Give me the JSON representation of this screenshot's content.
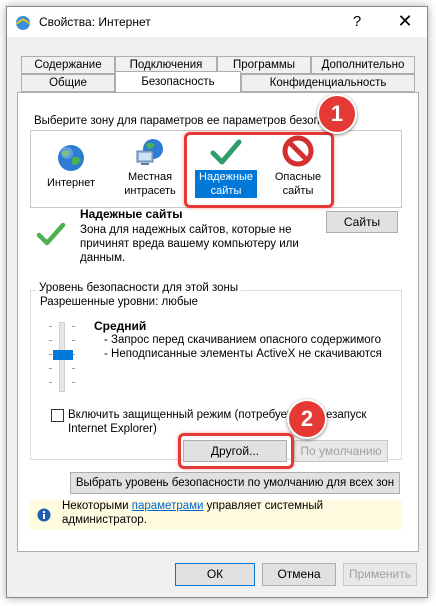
{
  "window": {
    "title": "Свойства: Интернет",
    "help_glyph": "?",
    "close_glyph": "✕"
  },
  "tabs": {
    "row_top": [
      "Содержание",
      "Подключения",
      "Программы",
      "Дополнительно"
    ],
    "row_bottom": [
      "Общие",
      "Безопасность",
      "Конфиденциальность"
    ],
    "active": "Безопасность"
  },
  "security": {
    "select_zone_prompt": "Выберите зону для параметров ее параметров безопасности.",
    "zones": [
      {
        "label_line1": "Интернет",
        "label_line2": "",
        "icon": "globe-icon"
      },
      {
        "label_line1": "Местная",
        "label_line2": "интрасеть",
        "icon": "intranet-icon"
      },
      {
        "label_line1": "Надежные",
        "label_line2": "сайты",
        "icon": "checkmark-icon",
        "selected": true
      },
      {
        "label_line1": "Опасные",
        "label_line2": "сайты",
        "icon": "restricted-icon"
      }
    ],
    "zone_info": {
      "title": "Надежные сайты",
      "line1": "Зона для надежных сайтов, которые не",
      "line2": "причинят вреда вашему компьютеру или",
      "line3": "данным.",
      "sites_button": "Сайты"
    },
    "level_group": {
      "title": "Уровень безопасности для этой зоны",
      "allowed_levels": "Разрешенные уровни: любые",
      "level_name": "Средний",
      "bullet1": "- Запрос перед скачиванием опасного содержимого",
      "bullet2": "- Неподписанные элементы ActiveX не скачиваются",
      "protected_mode_line1": "Включить защищенный режим (потребуется перезапуск",
      "protected_mode_line2": "Internet Explorer)",
      "protected_mode_checked": false,
      "custom_button": "Другой...",
      "default_button": "По умолчанию"
    },
    "reset_all_button": "Выбрать уровень безопасности по умолчанию для всех зон",
    "info": {
      "prefix": "Некоторыми ",
      "link": "параметрами",
      "suffix": " управляет системный",
      "line2": "администратор."
    }
  },
  "footer": {
    "ok": "ОК",
    "cancel": "Отмена",
    "apply": "Применить"
  },
  "annotations": {
    "badge1": "1",
    "badge2": "2",
    "color": "#e53935"
  }
}
